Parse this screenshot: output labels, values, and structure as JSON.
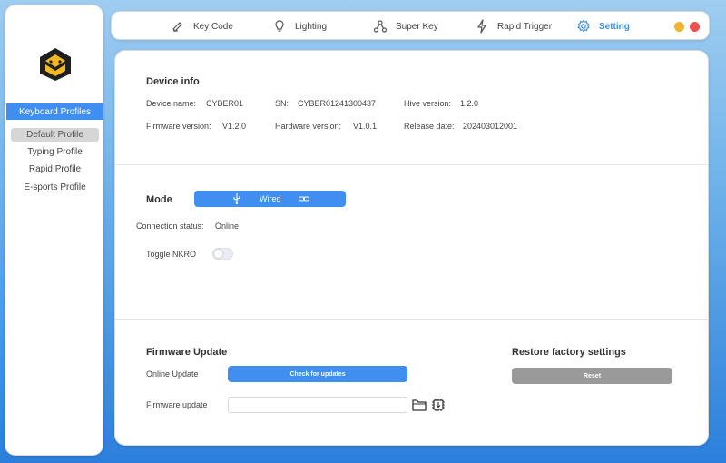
{
  "sidebar": {
    "header": "Keyboard Profiles",
    "profiles": [
      {
        "label": "Default Profile",
        "active": true
      },
      {
        "label": "Typing Profile",
        "active": false
      },
      {
        "label": "Rapid Profile",
        "active": false
      },
      {
        "label": "E-sports Profile",
        "active": false
      }
    ]
  },
  "tabs": [
    {
      "label": "Key Code",
      "icon": "key-code-icon"
    },
    {
      "label": "Lighting",
      "icon": "bulb-icon"
    },
    {
      "label": "Super Key",
      "icon": "super-key-icon"
    },
    {
      "label": "Rapid Trigger",
      "icon": "lightning-icon"
    },
    {
      "label": "Setting",
      "icon": "gear-icon",
      "active": true
    }
  ],
  "window_buttons": {
    "minimize_color": "#f2b332",
    "close_color": "#ee4f4f"
  },
  "device_info": {
    "title": "Device info",
    "device_name_label": "Device name:",
    "device_name": "CYBER01",
    "sn_label": "SN:",
    "sn": "CYBER01241300437",
    "hive_version_label": "Hive version:",
    "hive_version": "1.2.0",
    "firmware_version_label": "Firmware version:",
    "firmware_version": "V1.2.0",
    "hardware_version_label": "Hardware version:",
    "hardware_version": "V1.0.1",
    "release_date_label": "Release date:",
    "release_date": "202403012001"
  },
  "mode": {
    "title": "Mode",
    "selected": "Wired",
    "connection_status_label": "Connection status:",
    "connection_status": "Online",
    "toggle_nkro_label": "Toggle NKRO",
    "nkro_enabled": false
  },
  "firmware_update": {
    "title": "Firmware Update",
    "online_update_label": "Online Update",
    "check_button": "Check for updates",
    "firmware_update_label": "Firmware update",
    "file_value": ""
  },
  "restore": {
    "title": "Restore factory settings",
    "reset_button": "Reset"
  },
  "colors": {
    "accent": "#3f8ef0",
    "reset_grey": "#9a9a9a"
  }
}
